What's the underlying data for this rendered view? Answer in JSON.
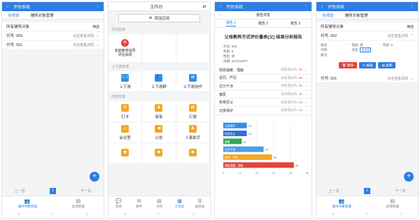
{
  "screen1": {
    "title": "评估系统",
    "sub_all": "全视觉",
    "sub_manage": "辅导对象管理",
    "filter_label": "所有辅导对象",
    "filter_right": "筛选",
    "rows": [
      {
        "label": "代号: 009",
        "action": "点击查看详情"
      },
      {
        "label": "代号: 001",
        "action": "点击查看详情"
      }
    ],
    "pager": {
      "prev": "上一页",
      "page": "1",
      "next": "下一页"
    },
    "nav": [
      {
        "label": "辅导对象管理"
      },
      {
        "label": "反馈管理"
      }
    ]
  },
  "screen2": {
    "title": "工作台",
    "add_app": "添加应用",
    "group1": "评估系统",
    "app1": "家庭教育指导评估系统",
    "group2": "上下游管理",
    "apps2": [
      "上下游",
      "上下游群",
      "上下游协作"
    ],
    "group3": "内部管理",
    "apps3": [
      "打卡",
      "审批",
      "汇报",
      "会议室",
      "公告",
      "人事助手"
    ],
    "nav": [
      "消息",
      "邮件",
      "文档",
      "工作台",
      "通讯录"
    ]
  },
  "screen3": {
    "top_title": "评估系统",
    "header": "报告浏览",
    "tabs": [
      "报告 1",
      "报告 2",
      "报告 3"
    ],
    "report_title": "父母教养方式评价量表(父) 结果分析报告",
    "meta": [
      "代号: 002",
      "年龄: 8",
      "性别: 男",
      "日期: 2022/10/07"
    ],
    "score_prefix": "您的得分为:",
    "scores": [
      {
        "name": "情感温暖、理解",
        "score": "42"
      },
      {
        "name": "惩罚、严厉",
        "score": "29"
      },
      {
        "name": "过分干涉",
        "score": "24"
      },
      {
        "name": "偏爱",
        "score": "11"
      },
      {
        "name": "拒绝否认",
        "score": "14"
      },
      {
        "name": "过度保护",
        "score": "14"
      }
    ]
  },
  "chart_data": {
    "type": "bar",
    "orientation": "horizontal",
    "categories": [
      "过度保护",
      "拒绝否认",
      "偏爱",
      "过分干涉",
      "惩罚、严厉",
      "情感温暖、理解"
    ],
    "values": [
      14,
      14,
      11,
      24,
      29,
      42
    ],
    "colors": [
      "#2f8fe8",
      "#2f6fd8",
      "#34a853",
      "#4a9fe8",
      "#f3a823",
      "#e3443a"
    ],
    "x_ticks": [
      0,
      10,
      20,
      30,
      40,
      50
    ],
    "xlim": [
      0,
      50
    ],
    "grid": true
  },
  "screen4": {
    "title": "评估系统",
    "sub_all": "全视觉",
    "sub_manage": "辅导对象管理",
    "filter_label": "所有辅导对象",
    "filter_right": "筛选",
    "row1": {
      "label": "代号: 002",
      "action": "点击查看详情"
    },
    "detail": {
      "name": "姓名:",
      "gender": "性别: 男",
      "age": "年龄: 8",
      "school": "学校:",
      "status_label": "状态:",
      "status_value": "未完成",
      "note": "备注:"
    },
    "buttons": [
      "删除",
      "编辑",
      "查看"
    ],
    "row2": {
      "label": "代号: 001",
      "action": "点击查看详情"
    },
    "pager": {
      "prev": "上一页",
      "page": "1",
      "next": "下一页"
    },
    "nav": [
      {
        "label": "辅导对象管理"
      },
      {
        "label": "反馈管理"
      }
    ]
  }
}
